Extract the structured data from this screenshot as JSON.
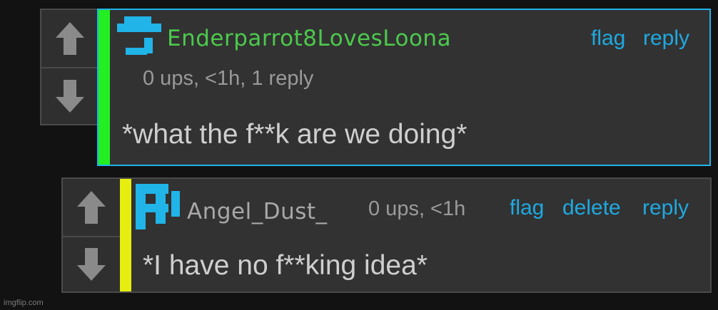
{
  "comments": [
    {
      "username": "Enderparrot8LovesLoona",
      "username_color": "#4cc94c",
      "meta": "0 ups, <1h, 1 reply",
      "actions": [
        "flag",
        "reply"
      ],
      "text": "*what the f**k are we doing*",
      "bar_color": "#22ee22",
      "highlight_border": "#20b4e8",
      "avatar_icon": "pixel-avatar-icon"
    },
    {
      "username": "Angel_Dust_",
      "username_color": "#a8a8a8",
      "meta": "0 ups, <1h",
      "actions": [
        "flag",
        "delete",
        "reply"
      ],
      "text": "*I have no f**king idea*",
      "bar_color": "#e6ee10",
      "avatar_icon": "pixel-avatar-icon"
    }
  ],
  "vote": {
    "up_icon": "upvote-arrow-icon",
    "down_icon": "downvote-arrow-icon"
  },
  "watermark": "imgflip.com"
}
